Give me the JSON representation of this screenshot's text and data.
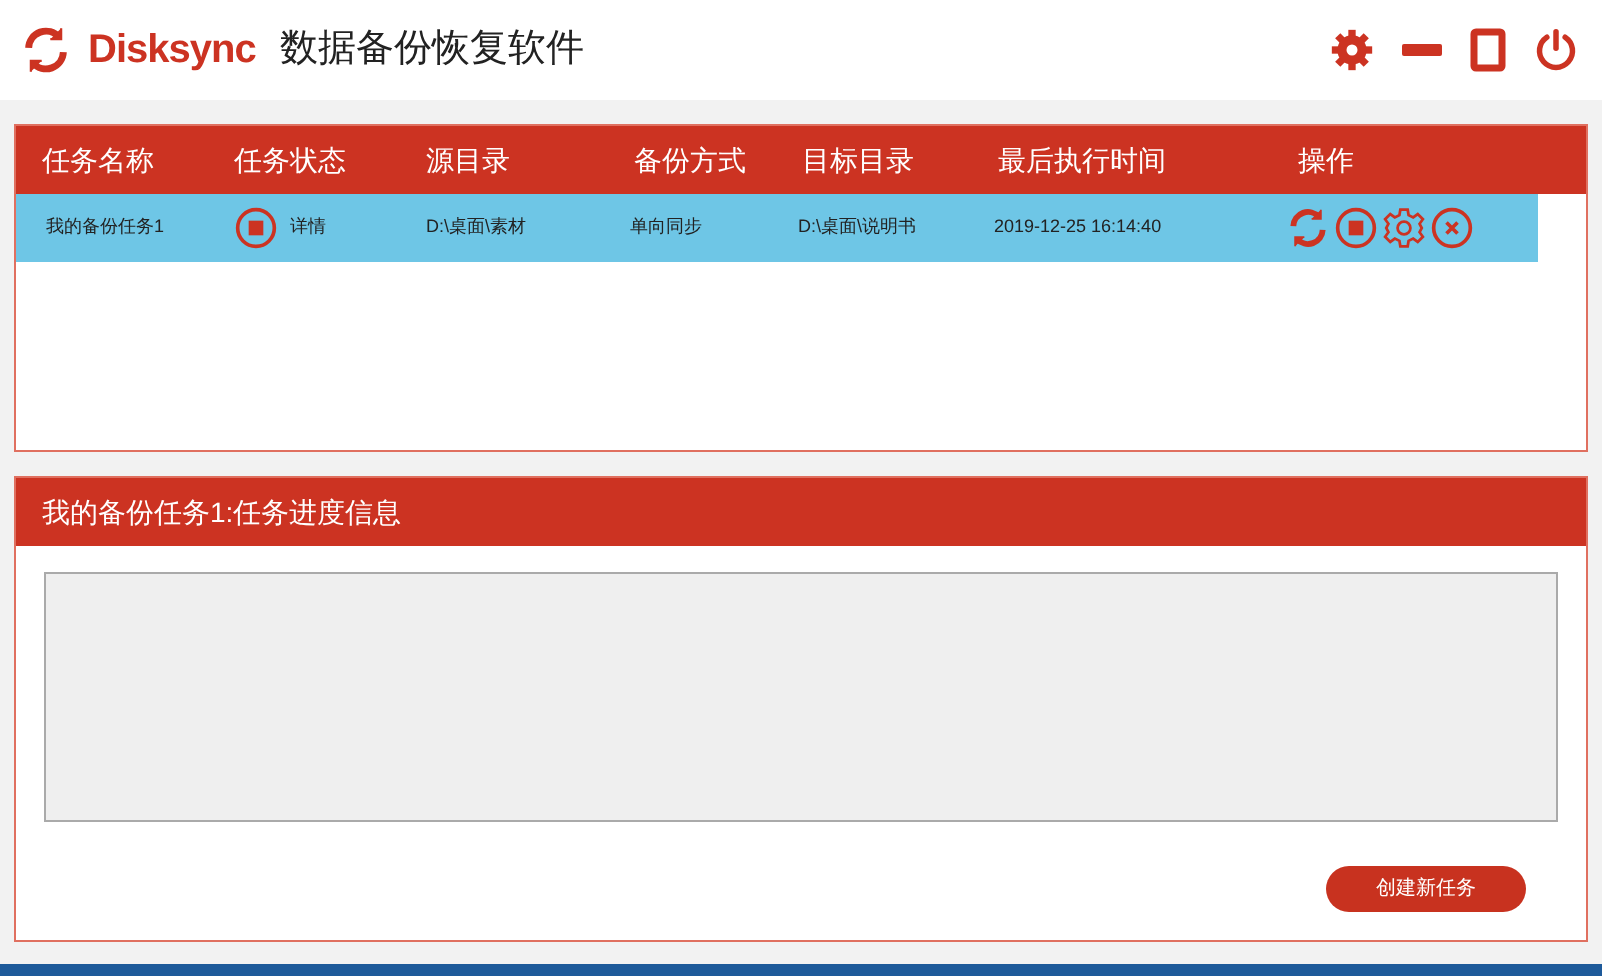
{
  "app": {
    "brand": "Disksync",
    "title": "数据备份恢复软件"
  },
  "task_table": {
    "columns": [
      "任务名称",
      "任务状态",
      "源目录",
      "备份方式",
      "目标目录",
      "最后执行时间",
      "操作"
    ],
    "rows": [
      {
        "name": "我的备份任务1",
        "status": "详情",
        "source": "D:\\桌面\\素材",
        "mode": "单向同步",
        "target": "D:\\桌面\\说明书",
        "last_run": "2019-12-25 16:14:40",
        "selected": true
      }
    ]
  },
  "progress_panel": {
    "title": "我的备份任务1:任务进度信息"
  },
  "create_button": "创建新任务"
}
